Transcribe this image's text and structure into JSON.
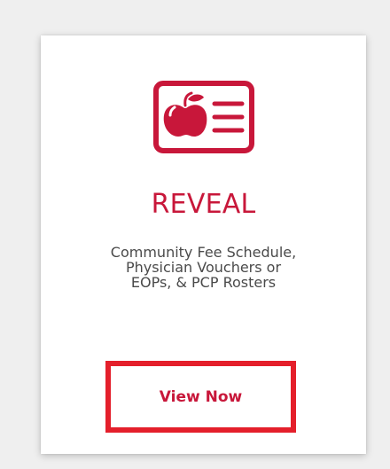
{
  "card": {
    "icon": "apple-list-icon",
    "title": "REVEAL",
    "description_lines": [
      "Community Fee Schedule,",
      "Physician Vouchers or",
      "EOPs, & PCP Rosters"
    ],
    "button_label": "View Now"
  },
  "colors": {
    "accent": "#c8173a",
    "button_border": "#e41f2b",
    "text": "#4a4a4a",
    "background": "#efefef",
    "card": "#ffffff"
  }
}
